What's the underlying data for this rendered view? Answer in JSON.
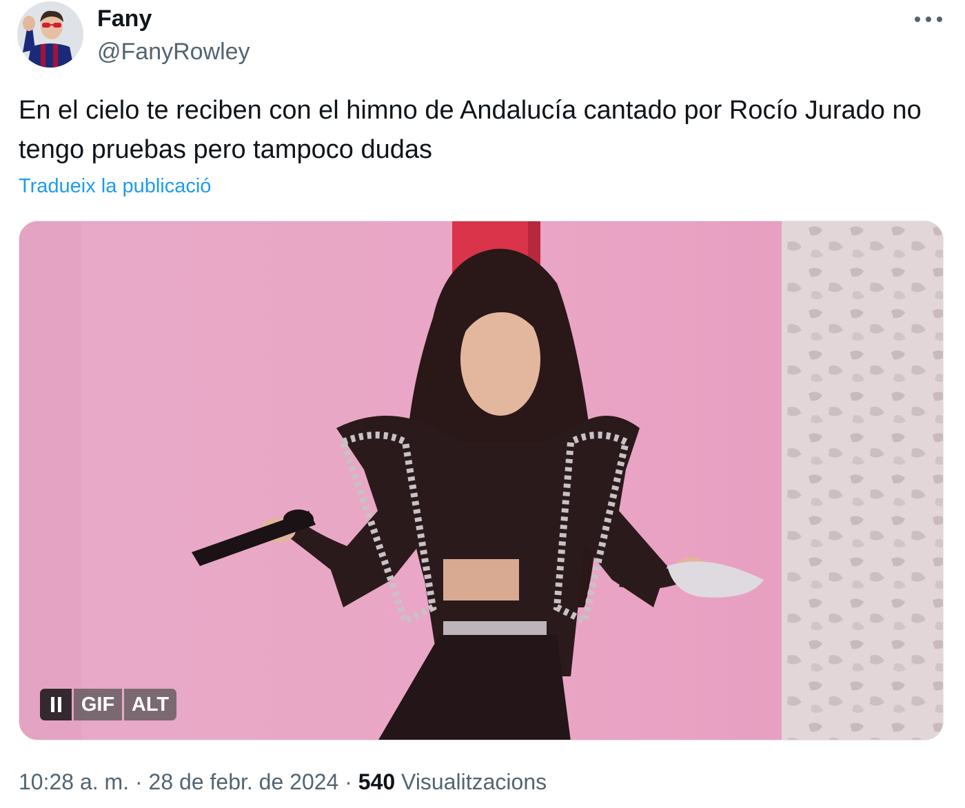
{
  "author": {
    "name": "Fany",
    "handle": "@FanyRowley"
  },
  "tweet": {
    "text": "En el cielo te reciben con el himno de Andalucía cantado por Rocío Jurado no tengo pruebas pero tampoco dudas",
    "translate_label": "Tradueix la publicació"
  },
  "media": {
    "pause_icon": "pause-icon",
    "gif_label": "GIF",
    "alt_label": "ALT"
  },
  "footer": {
    "time": "10:28 a. m.",
    "separator": "·",
    "date": "28 de febr. de 2024",
    "views_count": "540",
    "views_label": "Visualitzacions"
  },
  "colors": {
    "link": "#1d9bf0",
    "secondary_text": "#536471",
    "primary_text": "#0f1419"
  }
}
